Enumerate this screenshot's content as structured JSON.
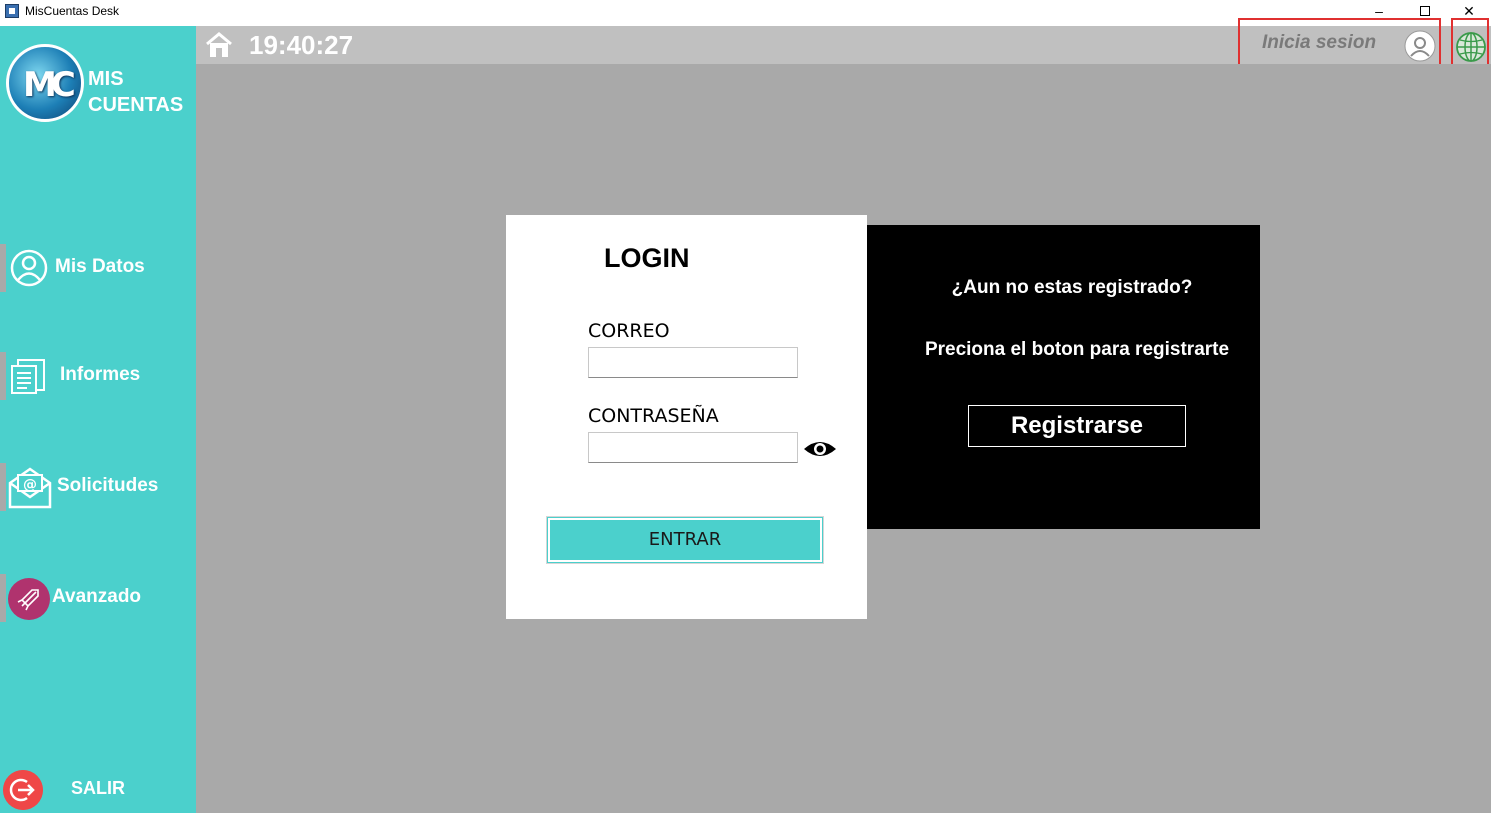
{
  "window": {
    "title": "MisCuentas Desk",
    "minimize": "–",
    "close": "✕"
  },
  "sidebar": {
    "logo_text": "MC",
    "brand_line1": "MIS",
    "brand_line2": "CUENTAS",
    "items": [
      {
        "label": "Mis Datos",
        "icon": "user-circle-icon"
      },
      {
        "label": "Informes",
        "icon": "document-icon"
      },
      {
        "label": "Solicitudes",
        "icon": "mail-at-icon"
      },
      {
        "label": "Avanzado",
        "icon": "rocket-icon"
      }
    ],
    "exit_label": "SALIR"
  },
  "header": {
    "clock": "19:40:27",
    "login_hint": "Inicia sesion"
  },
  "login": {
    "title": "LOGIN",
    "email_label": "CORREO",
    "email_value": "",
    "password_label": "CONTRASEÑA",
    "password_value": "",
    "enter_button": "ENTRAR"
  },
  "register": {
    "question": "¿Aun no estas registrado?",
    "hint": "Preciona el boton para registrarte",
    "button": "Registrarse"
  },
  "colors": {
    "accent": "#4bd0cc",
    "main_bg": "#a9a9a9",
    "header_bg": "#c0c0c0",
    "highlight": "#e03030",
    "exit": "#ef4747",
    "avanzado": "#b0336e"
  }
}
